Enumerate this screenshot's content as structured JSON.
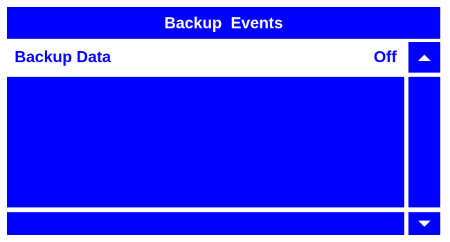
{
  "header": {
    "title": "Backup  Events"
  },
  "settings": {
    "backup_data": {
      "label": "Backup Data",
      "value": "Off"
    }
  },
  "scroll": {
    "up_icon": "triangle-up-icon",
    "down_icon": "triangle-down-icon"
  },
  "colors": {
    "primary_blue": "#0000ff",
    "background": "#ffffff",
    "text_on_blue": "#ffffff"
  }
}
